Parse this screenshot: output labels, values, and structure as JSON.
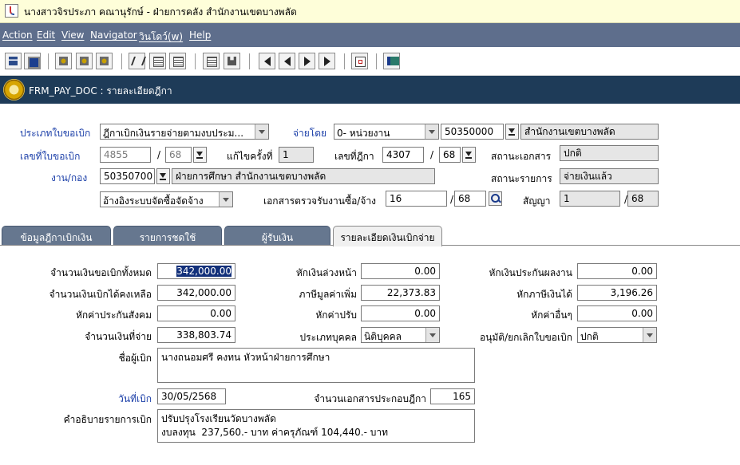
{
  "window": {
    "title": "นางสาวจิรประภา คณานุรักษ์ - ฝ่ายการคลัง สำนักงานเขตบางพลัด"
  },
  "menu": [
    "Action",
    "Edit",
    "View",
    "Navigator",
    "วินโดว์(w)",
    "Help"
  ],
  "form_header": {
    "title": "FRM_PAY_DOC : รายละเอียดฎีกา"
  },
  "form": {
    "doc_type_label": "ประเภทใบขอเบิก",
    "doc_type_value": "ฎีกาเบิกเงินรายจ่ายตามงบประม...",
    "pay_by_label": "จ่ายโดย",
    "pay_by_value": "0- หน่วยงาน",
    "pay_by_code": "50350000",
    "pay_by_name": "สำนักงานเขตบางพลัด",
    "doc_no_label": "เลขที่ใบขอเบิก",
    "doc_no_value": "4855",
    "doc_no_year": "68",
    "edit_count_label": "แก้ไขครั้งที่",
    "edit_count_value": "1",
    "dika_no_label": "เลขที่ฎีกา",
    "dika_no_value": "4307",
    "dika_no_year": "68",
    "doc_status_label": "สถานะเอกสาร",
    "doc_status_value": "ปกติ",
    "unit_label": "งาน/กอง",
    "unit_code": "50350700",
    "unit_name": "ฝ่ายการศึกษา สำนักงานเขตบางพลัด",
    "item_status_label": "สถานะรายการ",
    "item_status_value": "จ่ายเงินแล้ว",
    "ref_system_value": "อ้างอิงระบบจัดซื้อจัดจ้าง",
    "receipt_doc_label": "เอกสารตรวจรับงานซื้อ/จ้าง",
    "receipt_doc_no": "16",
    "receipt_doc_year": "68",
    "contract_label": "สัญญา",
    "contract_no": "1",
    "contract_year": "68",
    "slash": "/"
  },
  "tabs": [
    {
      "label": "ข้อมูลฎีกาเบิกเงิน",
      "active": false
    },
    {
      "label": "รายการชดใช้",
      "active": false
    },
    {
      "label": "ผู้รับเงิน",
      "active": false
    },
    {
      "label": "รายละเอียดเงินเบิกจ่าย",
      "active": true
    }
  ],
  "details": {
    "total_request_label": "จำนวนเงินขอเบิกทั้งหมด",
    "total_request_value": "342,000.00",
    "advance_deduct_label": "หักเงินล่วงหน้า",
    "advance_deduct_value": "0.00",
    "performance_deduct_label": "หักเงินประกันผลงาน",
    "performance_deduct_value": "0.00",
    "remaining_label": "จำนวนเงินเบิกได้คงเหลือ",
    "remaining_value": "342,000.00",
    "vat_label": "ภาษีมูลค่าเพิ่ม",
    "vat_value": "22,373.83",
    "income_tax_label": "หักภาษีเงินได้",
    "income_tax_value": "3,196.26",
    "social_security_label": "หักค่าประกันสังคม",
    "social_security_value": "0.00",
    "fine_label": "หักค่าปรับ",
    "fine_value": "0.00",
    "other_deduct_label": "หักค่าอื่นๆ",
    "other_deduct_value": "0.00",
    "pay_amount_label": "จำนวนเงินที่จ่าย",
    "pay_amount_value": "338,803.74",
    "person_type_label": "ประเภทบุคคล",
    "person_type_value": "นิติบุคคล",
    "approve_label": "อนุมัติ/ยกเลิกใบขอเบิก",
    "approve_value": "ปกติ",
    "requester_label": "ชื่อผู้เบิก",
    "requester_value": "นางถนอมศรี คงทน หัวหน้าฝ่ายการศึกษา",
    "date_label": "วันที่เบิก",
    "date_value": "30/05/2568",
    "attach_count_label": "จำนวนเอกสารประกอบฎีกา",
    "attach_count_value": "165",
    "desc_label": "คำอธิบายรายการเบิก",
    "desc_value": "ปรับปรุงโรงเรียนวัดบางพลัด\nงบลงทุน  237,560.- บาท ค่าครุภัณฑ์ 104,440.- บาท"
  }
}
